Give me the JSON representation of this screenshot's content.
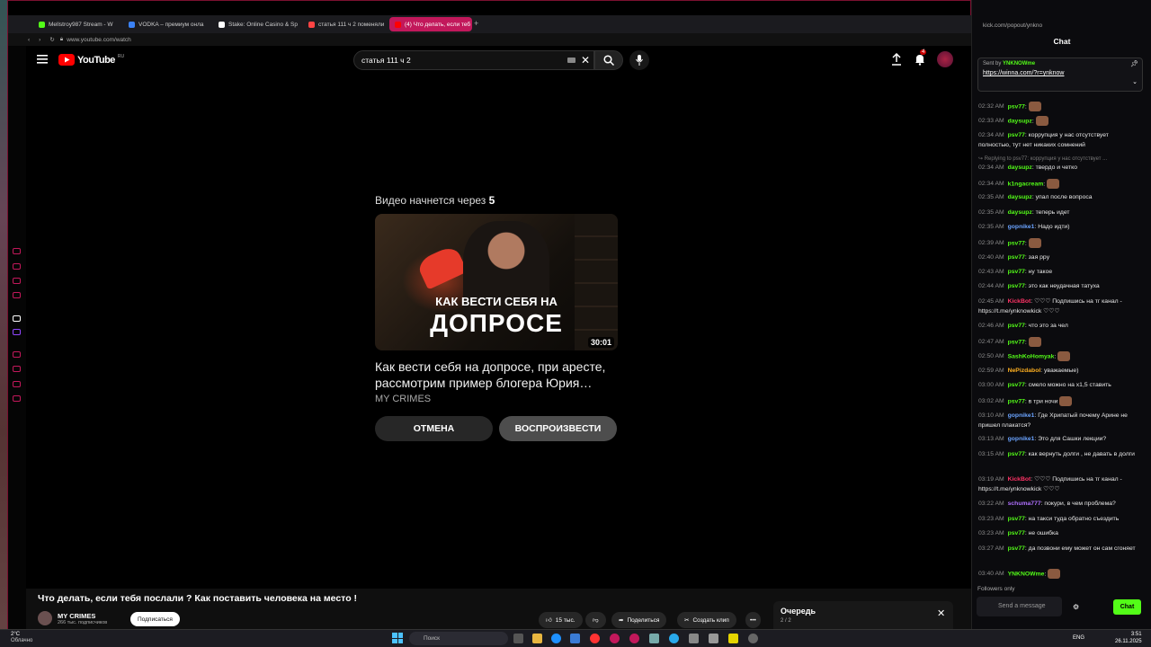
{
  "browser": {
    "tabs": [
      {
        "label": "Mellstroy987 Stream - W",
        "color": "#53fc18"
      },
      {
        "label": "VODKA – премиум онла",
        "color": "#3b82f6"
      },
      {
        "label": "Stake: Online Casino & Sp",
        "color": "#ffffff"
      },
      {
        "label": "статья 111 ч 2 поменяли",
        "color": "#ff4444"
      },
      {
        "label": "(4) Что делать, если теб",
        "color": "#ff0000"
      }
    ],
    "url": "www.youtube.com/watch"
  },
  "youtube": {
    "logo": "YouTube",
    "region": "RU",
    "search_value": "статья 111 ч 2",
    "notif_count": "4",
    "countdown_prefix": "Видео начнется через",
    "countdown_value": "5",
    "thumb_line1": "КАК ВЕСТИ СЕБЯ НА",
    "thumb_line2": "ДОПРОСЕ",
    "duration": "30:01",
    "next_title": "Как вести себя на допросе, при аресте, рассмотрим пример блогера Юрия…",
    "next_channel": "MY CRIMES",
    "cancel_label": "ОТМЕНА",
    "play_label": "ВОСПРОИЗВЕСТИ",
    "page_title": "Что делать, если тебя послали ? Как поставить человека на место !",
    "channel": "MY CRIMES",
    "subscribers": "266 тыс. подписчиков",
    "subscribe_label": "Подписаться",
    "likes": "15 тыс.",
    "share_label": "Поделиться",
    "clip_label": "Создать клип",
    "queue_title": "Очередь",
    "queue_count": "2 / 2"
  },
  "kick": {
    "url": "kick.com/popout/ynkno",
    "chat_title": "Chat",
    "pinned_sender_prefix": "Sent by",
    "pinned_sender": "YNKNOWme",
    "pinned_link": "https://winna.com/?r=ynknow",
    "messages": [
      {
        "time": "02:32 AM",
        "user": "psv77",
        "color": "#53fc18",
        "text": "",
        "emote": true
      },
      {
        "time": "02:33 AM",
        "user": "daysupz",
        "color": "#53fc18",
        "text": "",
        "emote": true
      },
      {
        "time": "02:34 AM",
        "user": "psv77",
        "color": "#53fc18",
        "text": "коррупция у нас отсутствует полностью, тут нет никаких сомнений"
      },
      {
        "time": "02:34 AM",
        "user": "daysupz",
        "color": "#53fc18",
        "text": "твердо и четко",
        "reply": "Replying to psv77: коррупция у нас отсутствует ..."
      },
      {
        "time": "02:34 AM",
        "user": "k1ngacream",
        "color": "#53fc18",
        "text": "",
        "emote": true
      },
      {
        "time": "02:35 AM",
        "user": "daysupz",
        "color": "#53fc18",
        "text": "упал после вопроса"
      },
      {
        "time": "02:35 AM",
        "user": "daysupz",
        "color": "#53fc18",
        "text": "теперь идет"
      },
      {
        "time": "02:35 AM",
        "user": "gopnike1",
        "color": "#6aa3ff",
        "text": "Надо идти)"
      },
      {
        "time": "02:39 AM",
        "user": "psv77",
        "color": "#53fc18",
        "text": "",
        "emote": true
      },
      {
        "time": "02:40 AM",
        "user": "psv77",
        "color": "#53fc18",
        "text": "зая ppy"
      },
      {
        "time": "02:43 AM",
        "user": "psv77",
        "color": "#53fc18",
        "text": "ну такое"
      },
      {
        "time": "02:44 AM",
        "user": "psv77",
        "color": "#53fc18",
        "text": "это как неудачная татуха"
      },
      {
        "time": "02:45 AM",
        "user": "KickBot",
        "color": "#ff3366",
        "text": "♡♡♡ Подпишись на тг канал - https://t.me/ynknowkick ♡♡♡"
      },
      {
        "time": "02:46 AM",
        "user": "psv77",
        "color": "#53fc18",
        "text": "что это за чел"
      },
      {
        "time": "02:47 AM",
        "user": "psv77",
        "color": "#53fc18",
        "text": "",
        "emote": true
      },
      {
        "time": "02:50 AM",
        "user": "SashKoHomyak",
        "color": "#53fc18",
        "text": "",
        "emote": true
      },
      {
        "time": "02:59 AM",
        "user": "NePizdabol",
        "color": "#ffb020",
        "text": "уважаемые)"
      },
      {
        "time": "03:00 AM",
        "user": "psv77",
        "color": "#53fc18",
        "text": "смело можно на х1,5 ставить"
      },
      {
        "time": "03:02 AM",
        "user": "psv77",
        "color": "#53fc18",
        "text": "в три ночи",
        "emote": true
      },
      {
        "time": "03:10 AM",
        "user": "gopnike1",
        "color": "#6aa3ff",
        "text": "Где Хрипатый почему Арине не пришел плакатся?"
      },
      {
        "time": "03:13 AM",
        "user": "gopnike1",
        "color": "#6aa3ff",
        "text": "Это для Сашки лекции?"
      },
      {
        "time": "03:15 AM",
        "user": "psv77",
        "color": "#53fc18",
        "text": "как вернуть долги , не давать в долги"
      },
      {
        "time": "03:19 AM",
        "user": "KickBot",
        "color": "#ff3366",
        "text": "♡♡♡ Подпишись на тг канал - https://t.me/ynknowkick ♡♡♡"
      },
      {
        "time": "03:22 AM",
        "user": "schuma777",
        "color": "#b070ff",
        "text": "покури, в чем проблема?"
      },
      {
        "time": "03:23 AM",
        "user": "psv77",
        "color": "#53fc18",
        "text": "на такси туда обратно съездить"
      },
      {
        "time": "03:23 AM",
        "user": "psv77",
        "color": "#53fc18",
        "text": "не ошибка"
      },
      {
        "time": "03:27 AM",
        "user": "psv77",
        "color": "#53fc18",
        "text": "да позвони ему может он сам сгоняет"
      },
      {
        "time": "03:40 AM",
        "user": "YNKNOWme",
        "color": "#53fc18",
        "text": "",
        "emote": true
      }
    ],
    "followers_only": "Followers only",
    "send_placeholder": "Send a message",
    "chat_button": "Chat"
  },
  "taskbar": {
    "weather_temp": "2°C",
    "weather_text": "Облачно",
    "search_placeholder": "Поиск",
    "lang": "ENG",
    "time": "3:51",
    "date": "26.11.2025"
  }
}
